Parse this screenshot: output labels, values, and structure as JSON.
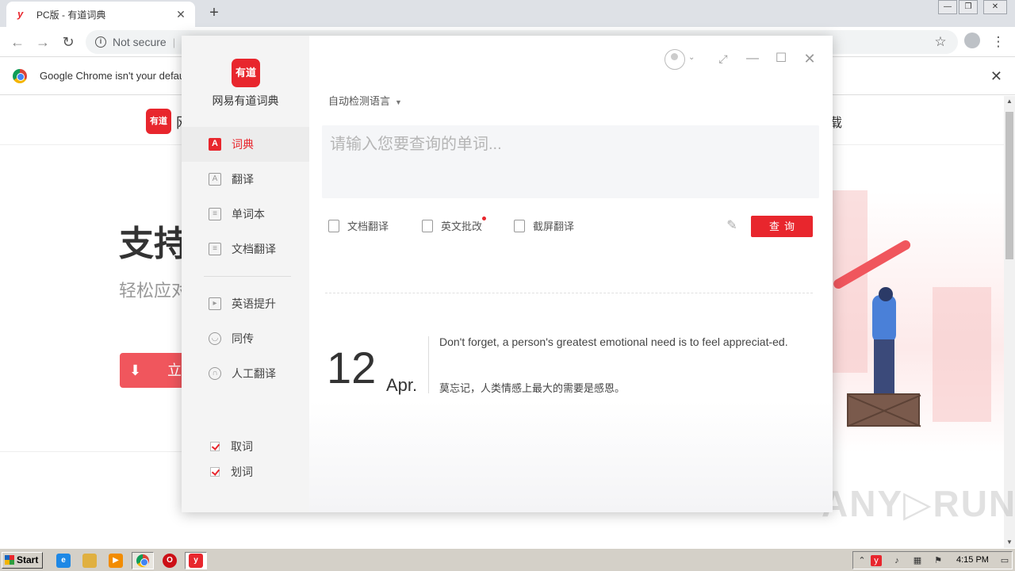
{
  "browser": {
    "tab_title": "PC版 - 有道词典",
    "tab_favicon": "y",
    "tab_close": "✕",
    "new_tab": "+",
    "address_security": "Not secure",
    "infobar_text": "Google Chrome isn't your default",
    "infobar_close": "✕"
  },
  "page": {
    "site_logo": "有道",
    "site_name_partial": "网",
    "nav_right_partial": "载",
    "hero_title": "支持",
    "hero_subtitle": "轻松应对",
    "download_btn_partial": "立",
    "watermark": "ANY▷RUN"
  },
  "app": {
    "logo": "有道",
    "name": "网易有道词典",
    "nav": [
      {
        "label": "词典",
        "icon": "A"
      },
      {
        "label": "翻译",
        "icon": "A"
      },
      {
        "label": "单词本",
        "icon": "≡"
      },
      {
        "label": "文档翻译",
        "icon": "≡"
      },
      {
        "label": "英语提升",
        "icon": "▸"
      },
      {
        "label": "同传",
        "icon": "◡"
      },
      {
        "label": "人工翻译",
        "icon": "∩"
      }
    ],
    "checks": [
      {
        "label": "取词",
        "checked": true
      },
      {
        "label": "划词",
        "checked": true
      }
    ],
    "language_select": "自动检测语言",
    "search_placeholder": "请输入您要查询的单词...",
    "tools": [
      "文档翻译",
      "英文批改",
      "截屏翻译"
    ],
    "query_button": "查询",
    "daily": {
      "day": "12",
      "month": "Apr.",
      "quote_en": "Don't forget, a person's greatest emotional need is to feel appreciat-ed.",
      "quote_zh": "莫忘记，人类情感上最大的需要是感恩。"
    },
    "accent_color": "#e8262d"
  },
  "taskbar": {
    "start_label": "Start",
    "clock": "4:15 PM"
  }
}
